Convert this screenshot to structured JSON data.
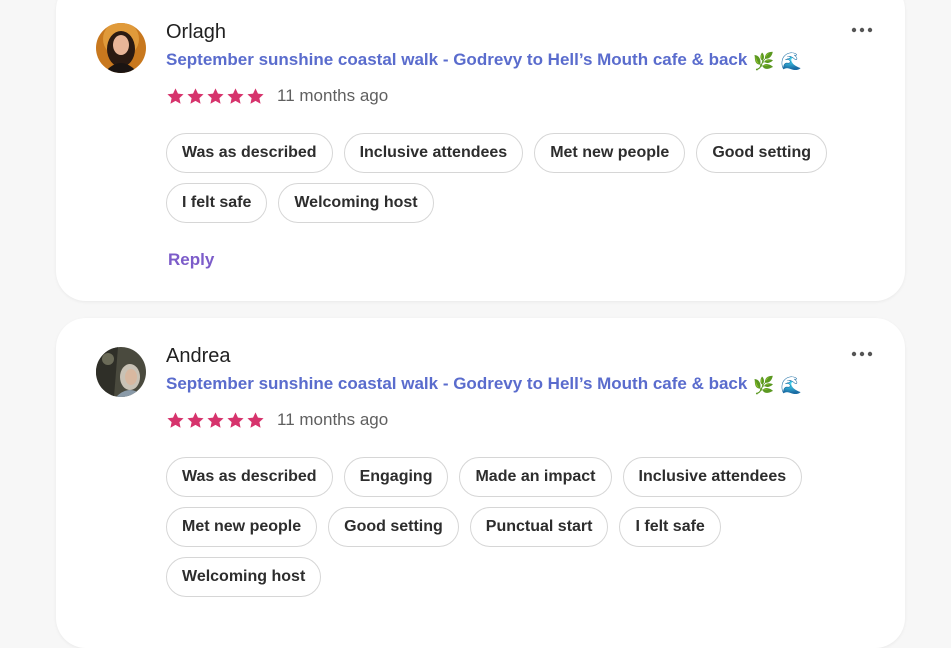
{
  "reviews": [
    {
      "name": "Orlagh",
      "event": "September sunshine coastal walk - Godrevy to Hell’s Mouth cafe & back",
      "event_emojis": [
        "🌿",
        "🌊"
      ],
      "rating": 5,
      "time": "11 months ago",
      "tags": [
        "Was as described",
        "Inclusive attendees",
        "Met new people",
        "Good setting",
        "I felt safe",
        "Welcoming host"
      ],
      "reply_label": "Reply"
    },
    {
      "name": "Andrea",
      "event": "September sunshine coastal walk - Godrevy to Hell’s Mouth cafe & back",
      "event_emojis": [
        "🌿",
        "🌊"
      ],
      "rating": 5,
      "time": "11 months ago",
      "tags": [
        "Was as described",
        "Engaging",
        "Made an impact",
        "Inclusive attendees",
        "Met new people",
        "Good setting",
        "Punctual start",
        "I felt safe",
        "Welcoming host"
      ]
    }
  ],
  "colors": {
    "event_link": "#5a6ccd",
    "star": "#d6336c",
    "reply": "#7c5cc9"
  },
  "icons": {
    "more": "more-options-icon",
    "star": "star-icon"
  }
}
